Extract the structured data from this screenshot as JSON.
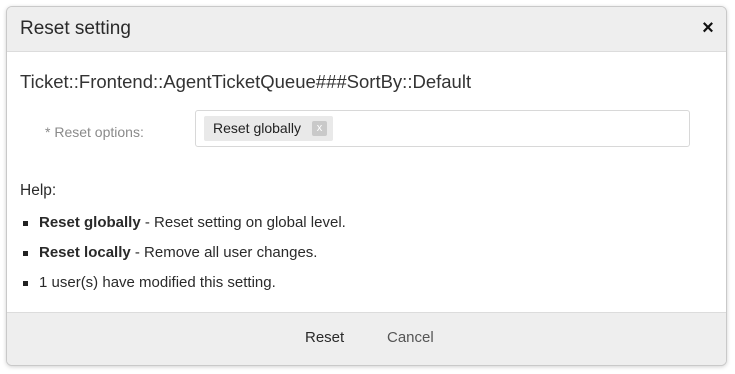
{
  "dialog": {
    "title": "Reset setting",
    "close_icon": "close-icon",
    "setting_name": "Ticket::Frontend::AgentTicketQueue###SortBy::Default"
  },
  "reset_options": {
    "required_marker": "*",
    "label": "Reset options:",
    "selected_tag": "Reset globally",
    "remove_glyph": "x"
  },
  "help": {
    "title": "Help:",
    "items": [
      {
        "term": "Reset globally",
        "text": " - Reset setting on global level."
      },
      {
        "term": "Reset locally",
        "text": " - Remove all user changes."
      },
      {
        "term": "",
        "text": "1 user(s) have modified this setting."
      }
    ]
  },
  "footer": {
    "reset_label": "Reset",
    "cancel_label": "Cancel"
  },
  "colors": {
    "header_bg": "#eeeeee",
    "footer_bg": "#eeeeee",
    "tag_bg": "#e9e9e9",
    "label_gray": "#8a8a8a"
  }
}
